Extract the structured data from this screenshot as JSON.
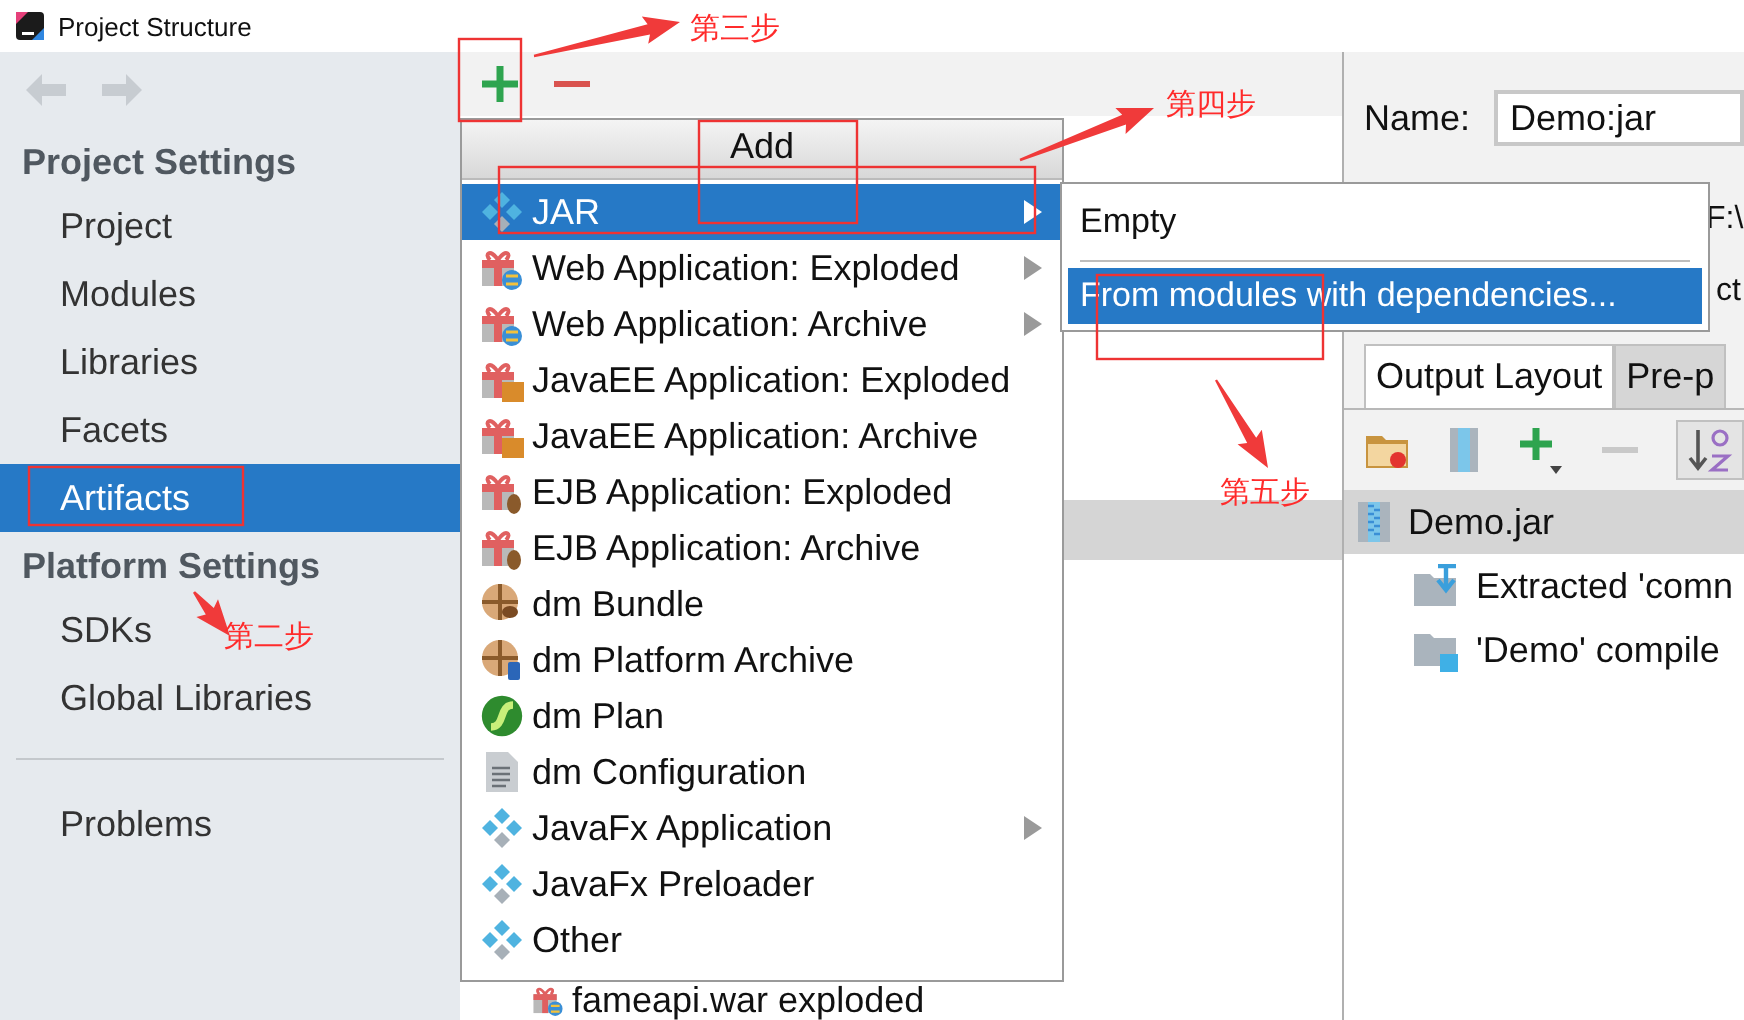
{
  "window": {
    "title": "Project Structure"
  },
  "sidebar": {
    "sections": [
      {
        "heading": "Project Settings",
        "items": [
          {
            "label": "Project",
            "selected": false
          },
          {
            "label": "Modules",
            "selected": false
          },
          {
            "label": "Libraries",
            "selected": false
          },
          {
            "label": "Facets",
            "selected": false
          },
          {
            "label": "Artifacts",
            "selected": true
          }
        ]
      },
      {
        "heading": "Platform Settings",
        "items": [
          {
            "label": "SDKs",
            "selected": false
          },
          {
            "label": "Global Libraries",
            "selected": false
          }
        ]
      },
      {
        "items": [
          {
            "label": "Problems",
            "selected": false
          }
        ]
      }
    ]
  },
  "artifacts_list": {
    "rows": [
      {
        "selected": true
      },
      {
        "label": "fameapi.war exploded",
        "kind": "web",
        "selected": false
      }
    ]
  },
  "add_menu": {
    "title": "Add",
    "items": [
      {
        "label": "JAR",
        "kind": "jar",
        "submenu": true,
        "selected": true
      },
      {
        "label": "Web Application: Exploded",
        "kind": "web",
        "submenu": true,
        "selected": false
      },
      {
        "label": "Web Application: Archive",
        "kind": "web",
        "submenu": true,
        "selected": false
      },
      {
        "label": "JavaEE Application: Exploded",
        "kind": "javaee",
        "submenu": false,
        "selected": false
      },
      {
        "label": "JavaEE Application: Archive",
        "kind": "javaee",
        "submenu": false,
        "selected": false
      },
      {
        "label": "EJB Application: Exploded",
        "kind": "ejb",
        "submenu": false,
        "selected": false
      },
      {
        "label": "EJB Application: Archive",
        "kind": "ejb",
        "submenu": false,
        "selected": false
      },
      {
        "label": "dm Bundle",
        "kind": "bundle",
        "submenu": false,
        "selected": false
      },
      {
        "label": "dm Platform Archive",
        "kind": "platform",
        "submenu": false,
        "selected": false
      },
      {
        "label": "dm Plan",
        "kind": "plan",
        "submenu": false,
        "selected": false
      },
      {
        "label": "dm Configuration",
        "kind": "config",
        "submenu": false,
        "selected": false
      },
      {
        "label": "JavaFx Application",
        "kind": "jar",
        "submenu": true,
        "selected": false
      },
      {
        "label": "JavaFx Preloader",
        "kind": "jar",
        "submenu": false,
        "selected": false
      },
      {
        "label": "Other",
        "kind": "jar",
        "submenu": false,
        "selected": false
      }
    ]
  },
  "jar_submenu": {
    "items": [
      {
        "kind": "item",
        "label": "Empty",
        "selected": false
      },
      {
        "kind": "separator"
      },
      {
        "kind": "item",
        "label": "From modules with dependencies...",
        "selected": true
      }
    ]
  },
  "artifact_editor": {
    "name_label": "Name:",
    "name_value": "Demo:jar",
    "covered_rows": [
      "F:\\",
      "ct"
    ],
    "tabs": [
      {
        "label": "Output Layout",
        "selected": true
      },
      {
        "label": "Pre-p",
        "selected": false
      }
    ],
    "tree": [
      {
        "label": "Demo.jar",
        "kind": "archive",
        "selected": true,
        "children": [
          {
            "label": "Extracted 'comn",
            "kind": "extracted",
            "selected": false
          },
          {
            "label": "'Demo' compile",
            "kind": "module-output",
            "selected": false
          }
        ]
      }
    ]
  },
  "annotations": [
    {
      "text": "第三步"
    },
    {
      "text": "第四步"
    },
    {
      "text": "第五步"
    },
    {
      "text": "第二步"
    }
  ]
}
